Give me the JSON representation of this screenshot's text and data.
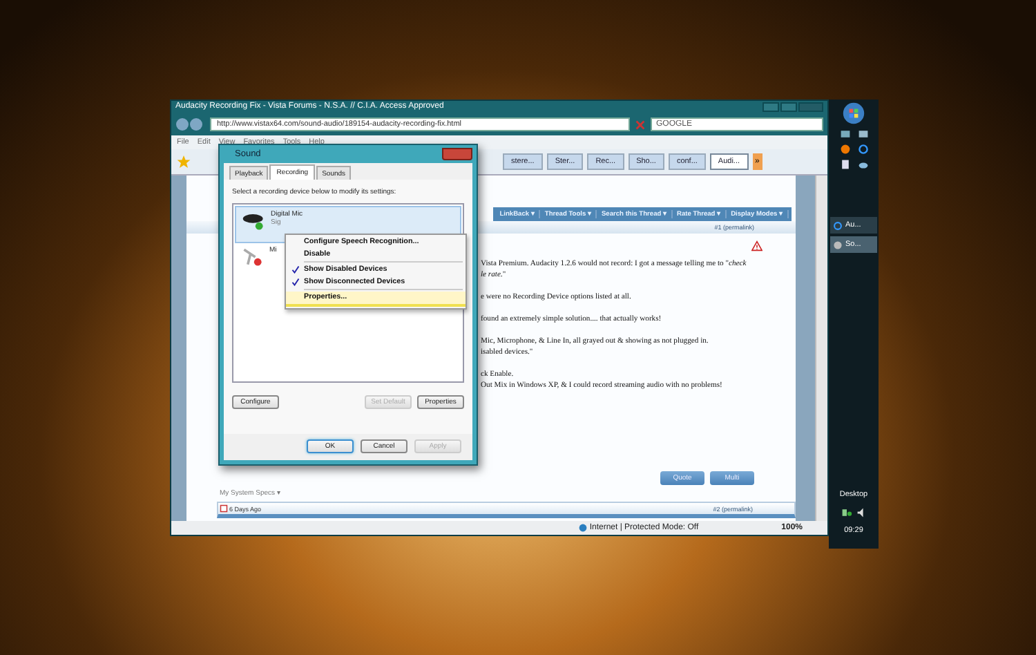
{
  "browser": {
    "title": "Audacity Recording Fix - Vista Forums - N.S.A. // C.I.A. Access Approved",
    "address": "http://www.vistax64.com/sound-audio/189154-audacity-recording-fix.html",
    "search_placeholder": "GOOGLE",
    "menu": [
      "File",
      "Edit",
      "View",
      "Favorites",
      "Tools",
      "Help"
    ],
    "tabs": [
      {
        "label": "stere...",
        "selected": false
      },
      {
        "label": "Ster...",
        "selected": false
      },
      {
        "label": "Rec...",
        "selected": false
      },
      {
        "label": "Sho...",
        "selected": false
      },
      {
        "label": "conf...",
        "selected": false
      },
      {
        "label": "Audi...",
        "selected": true
      }
    ],
    "more_tabs": "»",
    "thread_tools": [
      "LinkBack ▾",
      "Thread Tools ▾",
      "Search this Thread ▾",
      "Rate Thread ▾",
      "Display Modes ▾"
    ],
    "post1": {
      "permalink": "#1 (permalink)",
      "paragraphs": [
        [
          "Vista Premium. Audacity 1.2.6 would not record: I got a message telling me to \"*check*",
          "*le rate.*\""
        ],
        [
          "e were no Recording Device options listed at all."
        ],
        [
          "found an extremely simple solution.... that actually works!"
        ],
        [
          "Mic, Microphone, & Line In, all grayed out & showing as not plugged in.",
          "isabled devices.\""
        ],
        [
          "ck Enable.",
          "Out Mix in Windows XP, & I could record streaming audio with no problems!"
        ]
      ]
    },
    "post_buttons": [
      "Quote",
      "Multi"
    ],
    "system_specs": "My System Specs ▾",
    "post2": {
      "date": "6 Days Ago",
      "permalink": "#2 (permalink)"
    },
    "status": {
      "zone": "Internet | Protected Mode: Off",
      "zoom": "100%"
    }
  },
  "dialog": {
    "title": "Sound",
    "tabs": [
      {
        "label": "Playback",
        "selected": false
      },
      {
        "label": "Recording",
        "selected": true
      },
      {
        "label": "Sounds",
        "selected": false
      }
    ],
    "instruction": "Select a recording device below to modify its settings:",
    "devices": [
      {
        "name": "Digital Mic",
        "lines": [
          "Sig"
        ],
        "selected": true,
        "connected": true
      },
      {
        "name": "Mi",
        "selected": false,
        "connected": false
      }
    ],
    "context_menu": [
      [
        {
          "label": "Configure Speech Recognition...",
          "checked": false,
          "selected": false
        },
        {
          "label": "Disable",
          "checked": false,
          "selected": false
        }
      ],
      [
        {
          "label": "Show Disabled Devices",
          "checked": true,
          "selected": false
        },
        {
          "label": "Show Disconnected Devices",
          "checked": true,
          "selected": false
        }
      ],
      [
        {
          "label": "Properties...",
          "checked": false,
          "selected": true
        }
      ]
    ],
    "device_buttons": [
      {
        "label": "Configure",
        "disabled": false
      },
      {
        "label": "Set Default",
        "disabled": true
      },
      {
        "label": "Properties",
        "disabled": false
      }
    ],
    "footer_buttons": [
      {
        "label": "OK",
        "disabled": false,
        "default": true
      },
      {
        "label": "Cancel",
        "disabled": false,
        "default": false
      },
      {
        "label": "Apply",
        "disabled": true,
        "default": false
      }
    ]
  },
  "taskbar": {
    "tasks": [
      {
        "label": "Au...",
        "selected": false
      },
      {
        "label": "So...",
        "selected": true
      }
    ],
    "desktop_label": "Desktop",
    "clock": "09:29"
  }
}
